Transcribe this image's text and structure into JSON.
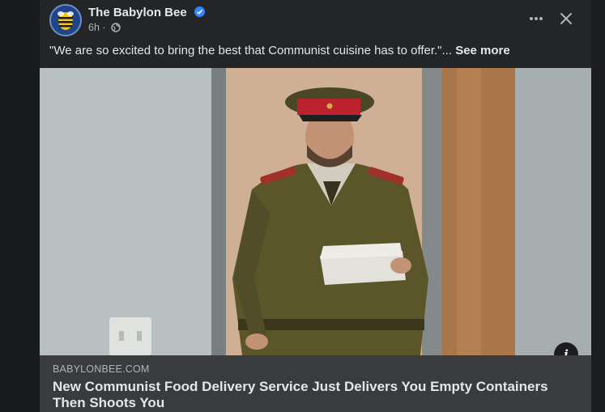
{
  "post": {
    "page_name": "The Babylon Bee",
    "timestamp": "6h",
    "separator": "·",
    "audience_icon": "globe-icon",
    "verified_icon": "verified-badge-icon",
    "verified_color": "#2d88ff",
    "caption_text": "\"We are so excited to bring the best that Communist cuisine has to offer.\"...",
    "see_more_label": "See more"
  },
  "toolbar": {
    "more_icon": "more-options-icon",
    "close_icon": "close-icon"
  },
  "link_preview": {
    "domain": "BABYLONBEE.COM",
    "headline": "New Communist Food Delivery Service Just Delivers You Empty Containers Then Shoots You",
    "info_label": "i"
  },
  "colors": {
    "card_bg": "#242526",
    "footer_bg": "#3a3b3c",
    "text_primary": "#e4e6eb",
    "text_secondary": "#b0b3b8"
  }
}
